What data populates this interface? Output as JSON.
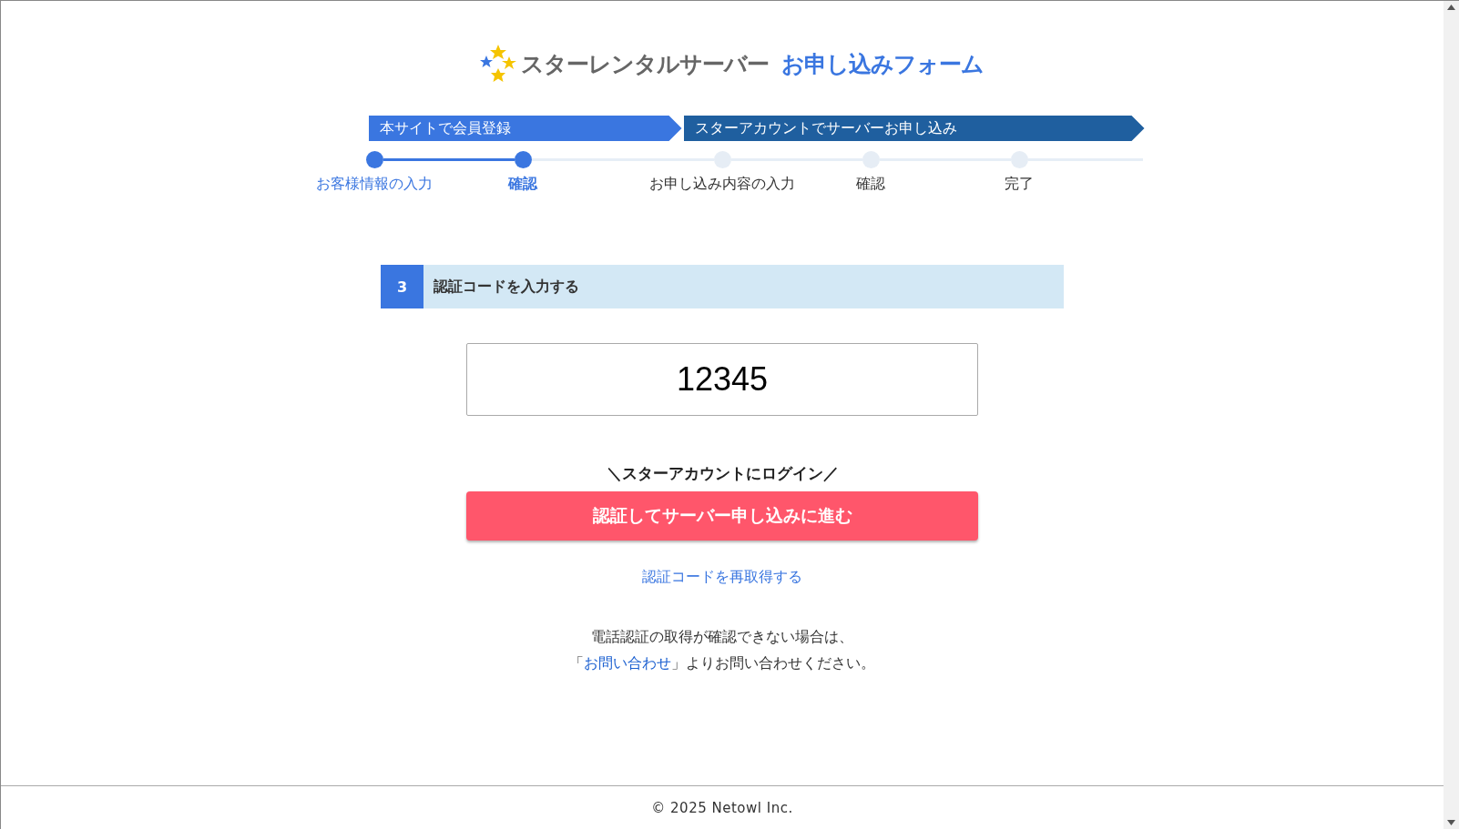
{
  "logo": {
    "brand": "スターレンタルサーバー",
    "title": "お申し込みフォーム"
  },
  "phases": [
    {
      "label": "本サイトで会員登録",
      "color": "#3a76e0"
    },
    {
      "label": "スターアカウントでサーバーお申し込み",
      "color": "#1f5f9f"
    }
  ],
  "steps": [
    {
      "label": "お客様情報の入力",
      "reached": true,
      "selected": false
    },
    {
      "label": "確認",
      "reached": true,
      "selected": true
    },
    {
      "label": "お申し込み内容の入力",
      "reached": false,
      "selected": false
    },
    {
      "label": "確認",
      "reached": false,
      "selected": false
    },
    {
      "label": "完了",
      "reached": false,
      "selected": false
    }
  ],
  "section": {
    "number": "3",
    "title": "認証コードを入力する"
  },
  "code_field": {
    "value": "12345"
  },
  "login_caption": "＼スターアカウントにログイン／",
  "submit_button": "認証してサーバー申し込みに進む",
  "resend_link": "認証コードを再取得する",
  "note": {
    "line1": "電話認証の取得が確認できない場合は、",
    "open": "「",
    "link": "お問い合わせ",
    "close": "」よりお問い合わせください。"
  },
  "footer": "© 2025 Netowl Inc."
}
